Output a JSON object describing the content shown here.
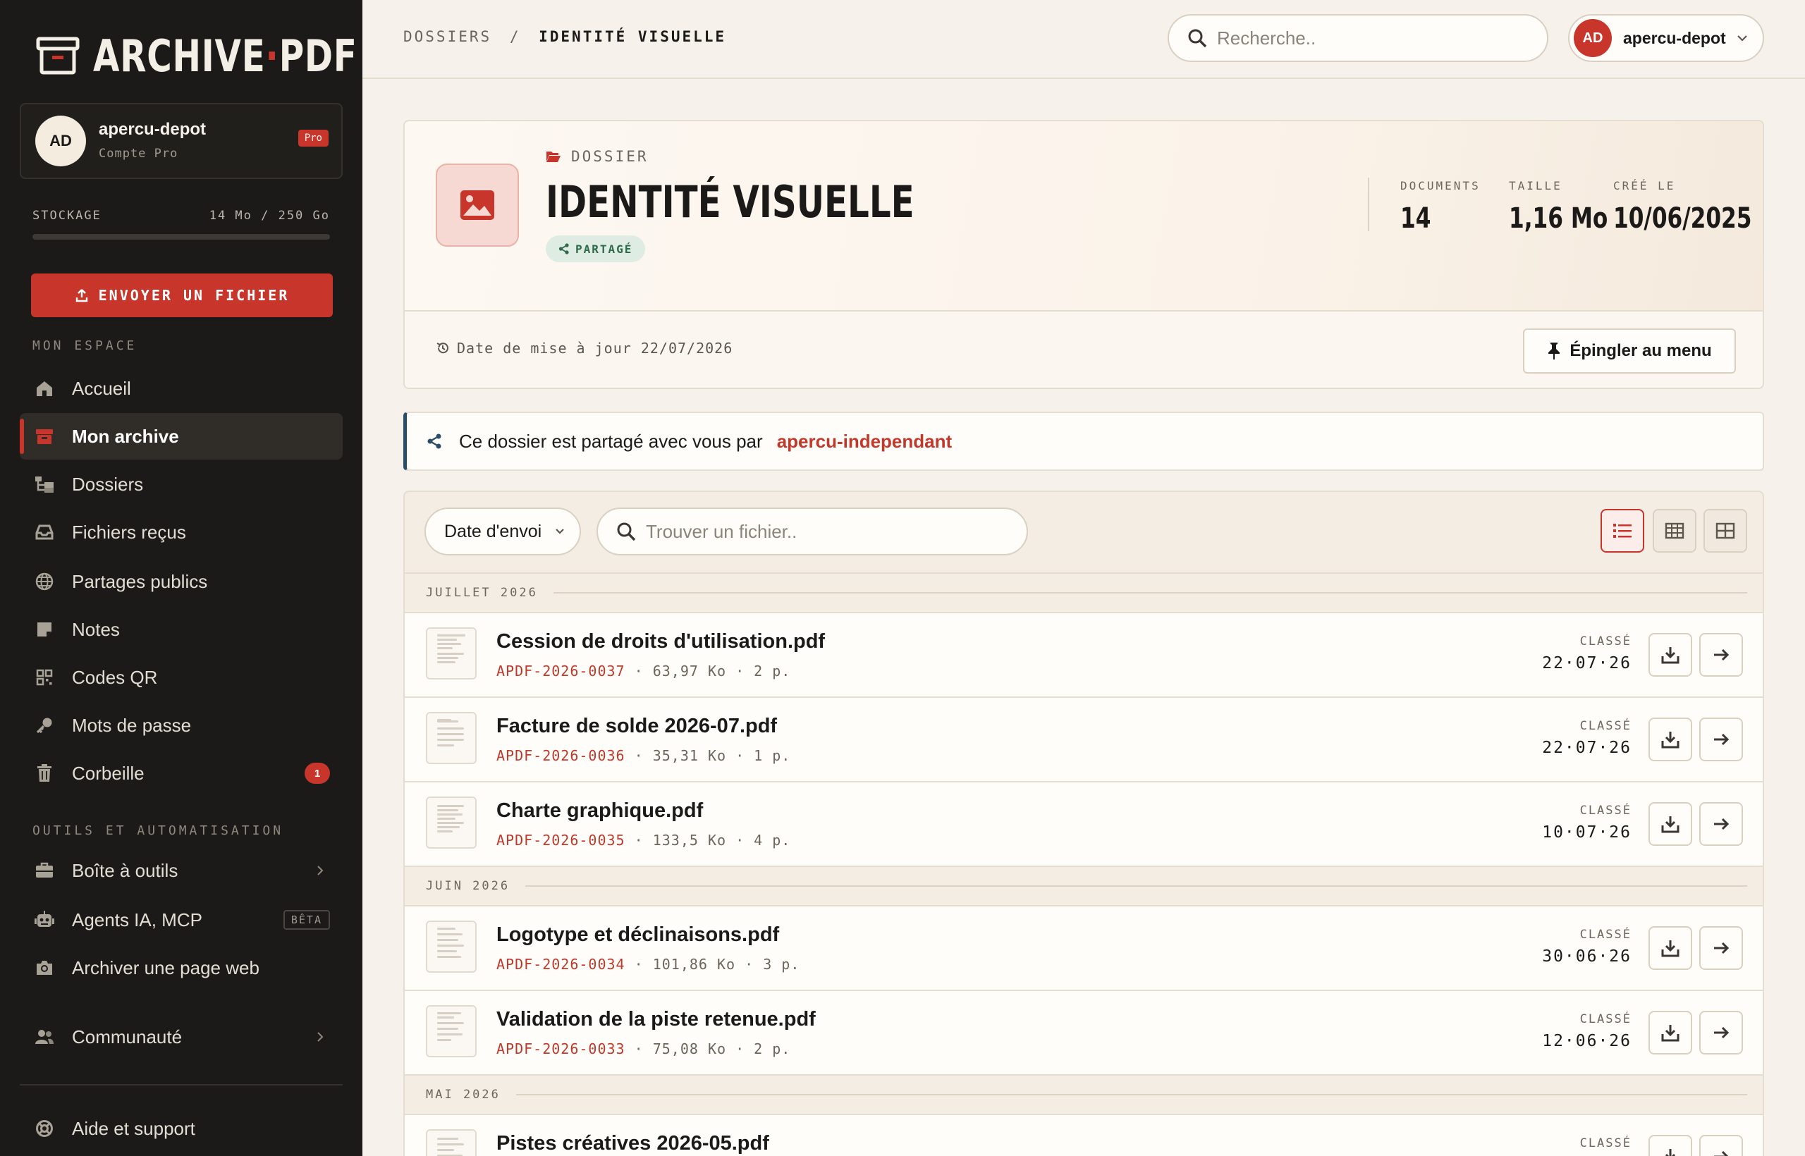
{
  "brand": {
    "name_left": "ARCHIVE",
    "name_dot": "·",
    "name_right": "PDF"
  },
  "user": {
    "initials": "AD",
    "name": "apercu-depot",
    "plan": "Compte Pro",
    "badge": "Pro"
  },
  "storage": {
    "label": "STOCKAGE",
    "value": "14 Mo / 250 Go",
    "used_fraction": 0.0001
  },
  "upload_label": "ENVOYER UN FICHIER",
  "nav": {
    "section_main": "MON ESPACE",
    "main": [
      {
        "label": "Accueil",
        "icon": "home-icon"
      },
      {
        "label": "Mon archive",
        "icon": "archive-box-icon",
        "active": true
      },
      {
        "label": "Dossiers",
        "icon": "folder-tree-icon"
      },
      {
        "label": "Fichiers reçus",
        "icon": "inbox-icon"
      },
      {
        "label": "Partages publics",
        "icon": "globe-icon"
      },
      {
        "label": "Notes",
        "icon": "note-icon"
      },
      {
        "label": "Codes QR",
        "icon": "qr-code-icon"
      },
      {
        "label": "Mots de passe",
        "icon": "key-icon"
      },
      {
        "label": "Corbeille",
        "icon": "trash-icon",
        "count": "1"
      }
    ],
    "section_tools": "OUTILS ET AUTOMATISATION",
    "tools": [
      {
        "label": "Boîte à outils",
        "icon": "toolbox-icon"
      },
      {
        "label": "Agents IA, MCP",
        "icon": "robot-icon",
        "badge": "BÊTA"
      },
      {
        "label": "Archiver une page web",
        "icon": "camera-icon"
      }
    ],
    "community": {
      "label": "Communauté",
      "icon": "users-icon"
    },
    "help": {
      "label": "Aide et support",
      "icon": "life-ring-icon"
    }
  },
  "topbar": {
    "breadcrumb_parent": "DOSSIERS",
    "breadcrumb_sep": "/",
    "breadcrumb_current": "IDENTITÉ VISUELLE",
    "search_placeholder": "Recherche..",
    "user_initials": "AD",
    "user_name": "apercu-depot"
  },
  "folder": {
    "kicker": "DOSSIER",
    "title": "IDENTITÉ VISUELLE",
    "shared_label": "PARTAGÉ",
    "stats": [
      {
        "label": "DOCUMENTS",
        "value": "14"
      },
      {
        "label": "TAILLE",
        "value": "1,16 Mo"
      },
      {
        "label": "CRÉÉ LE",
        "value": "10/06/2025"
      }
    ],
    "updated": "Date de mise à jour 22/07/2026",
    "pin_label": "Épingler au menu"
  },
  "share_banner": {
    "text": "Ce dossier est partagé avec vous par",
    "owner": "apercu-independant"
  },
  "files": {
    "sort_label": "Date d'envoi",
    "search_placeholder": "Trouver un fichier..",
    "status_label": "CLASSÉ",
    "groups": [
      {
        "label": "JUILLET 2026",
        "items": [
          {
            "name": "Cession de droits d'utilisation.pdf",
            "ref": "APDF-2026-0037",
            "size": "63,97 Ko",
            "pages": "2 p.",
            "date": "22·07·26"
          },
          {
            "name": "Facture de solde 2026-07.pdf",
            "ref": "APDF-2026-0036",
            "size": "35,31 Ko",
            "pages": "1 p.",
            "date": "22·07·26"
          },
          {
            "name": "Charte graphique.pdf",
            "ref": "APDF-2026-0035",
            "size": "133,5 Ko",
            "pages": "4 p.",
            "date": "10·07·26"
          }
        ]
      },
      {
        "label": "JUIN 2026",
        "items": [
          {
            "name": "Logotype et déclinaisons.pdf",
            "ref": "APDF-2026-0034",
            "size": "101,86 Ko",
            "pages": "3 p.",
            "date": "30·06·26"
          },
          {
            "name": "Validation de la piste retenue.pdf",
            "ref": "APDF-2026-0033",
            "size": "75,08 Ko",
            "pages": "2 p.",
            "date": "12·06·26"
          }
        ]
      },
      {
        "label": "MAI 2026",
        "items": [
          {
            "name": "Pistes créatives 2026-05.pdf",
            "ref": "",
            "size": "",
            "pages": "",
            "date": ""
          }
        ]
      }
    ]
  },
  "colors": {
    "accent": "#c8362b",
    "sidebar": "#1b1a18",
    "background": "#f6f1ea",
    "share_accent": "#2a4e6a"
  }
}
